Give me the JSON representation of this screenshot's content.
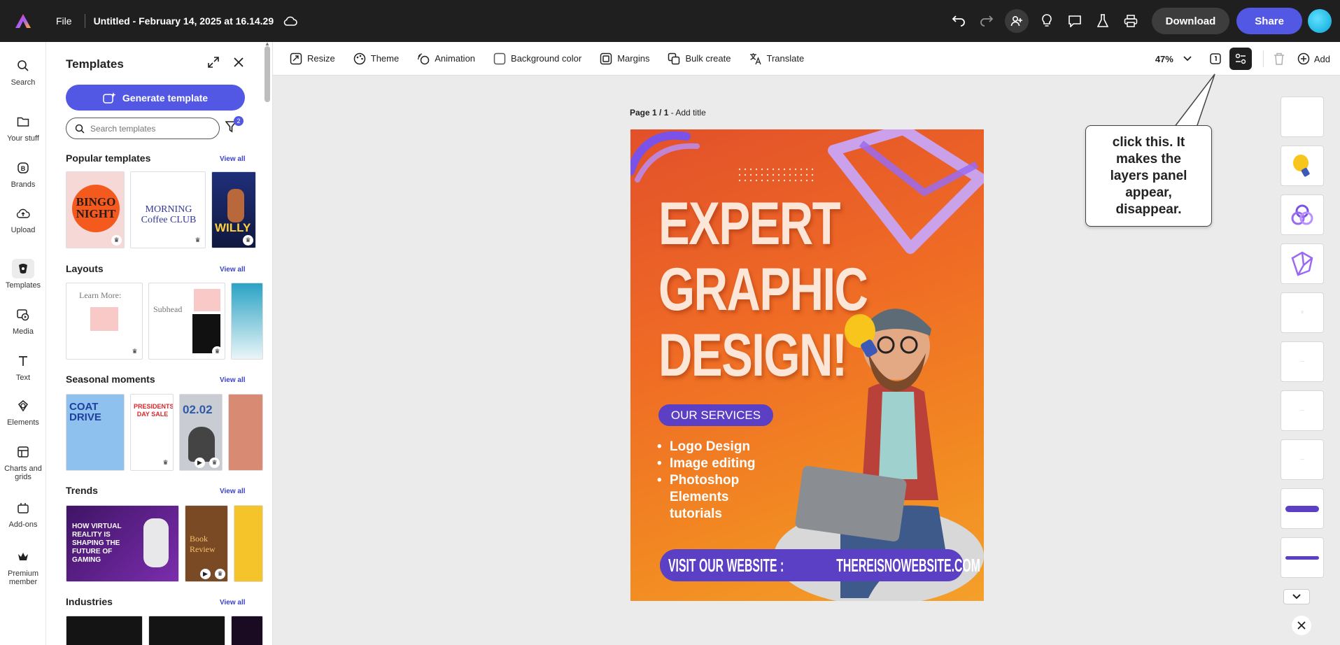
{
  "topbar": {
    "file_label": "File",
    "doc_title": "Untitled - February 14, 2025 at 16.14.29",
    "download_label": "Download",
    "share_label": "Share"
  },
  "rail": {
    "items": [
      {
        "label": "Search",
        "icon": "search-icon"
      },
      {
        "label": "Your stuff",
        "icon": "folder-icon"
      },
      {
        "label": "Brands",
        "icon": "brand-icon"
      },
      {
        "label": "Upload",
        "icon": "upload-icon"
      },
      {
        "label": "Templates",
        "icon": "templates-icon"
      },
      {
        "label": "Media",
        "icon": "media-icon"
      },
      {
        "label": "Text",
        "icon": "text-icon"
      },
      {
        "label": "Elements",
        "icon": "elements-icon"
      },
      {
        "label": "Charts and grids",
        "icon": "charts-icon"
      },
      {
        "label": "Add-ons",
        "icon": "addons-icon"
      },
      {
        "label": "Premium member",
        "icon": "crown-icon"
      }
    ]
  },
  "panel": {
    "title": "Templates",
    "generate_label": "Generate template",
    "search_placeholder": "Search templates",
    "filter_count": "2",
    "view_all": "View all",
    "sections": [
      {
        "title": "Popular templates"
      },
      {
        "title": "Layouts"
      },
      {
        "title": "Seasonal moments"
      },
      {
        "title": "Trends"
      },
      {
        "title": "Industries"
      }
    ],
    "thumb_text": {
      "bingo": "BINGO NIGHT",
      "morning": "MORNING Coffee CLUB",
      "willy": "WILLY",
      "learn": "Learn More:",
      "subhead": "Subhead",
      "coat": "COAT DRIVE",
      "presidents": "PRESIDENTS' DAY SALE",
      "date": "02.02",
      "vr": "HOW VIRTUAL REALITY IS SHAPING THE FUTURE OF GAMING",
      "book": "Book Review"
    }
  },
  "toolbar": {
    "items": [
      {
        "label": "Resize",
        "icon": "resize-icon"
      },
      {
        "label": "Theme",
        "icon": "theme-icon"
      },
      {
        "label": "Animation",
        "icon": "animation-icon"
      },
      {
        "label": "Background color",
        "icon": "checkbox-icon"
      },
      {
        "label": "Margins",
        "icon": "margins-icon"
      },
      {
        "label": "Bulk create",
        "icon": "bulk-create-icon"
      },
      {
        "label": "Translate",
        "icon": "translate-icon"
      }
    ],
    "zoom": "47%",
    "add_label": "Add"
  },
  "canvas": {
    "page_number": "Page 1 / 1",
    "page_title_suffix": " - Add title",
    "poster": {
      "headline": [
        "EXPERT",
        "GRAPHIC",
        "DESIGN!"
      ],
      "services_label": "OUR SERVICES",
      "services": [
        "Logo Design",
        "Image editing",
        "Photoshop",
        "Elements",
        "tutorials"
      ],
      "website_label": "VISIT OUR WEBSITE :",
      "website_url": "THEREISNOWEBSITE.COM"
    }
  },
  "callout": {
    "text": "click this.  It makes the layers panel appear, disappear."
  },
  "colors": {
    "accent": "#5258e4",
    "topbar": "#1f1f1f",
    "poster_purple": "#5b3fc4",
    "poster_orange": "#ef6b25"
  }
}
